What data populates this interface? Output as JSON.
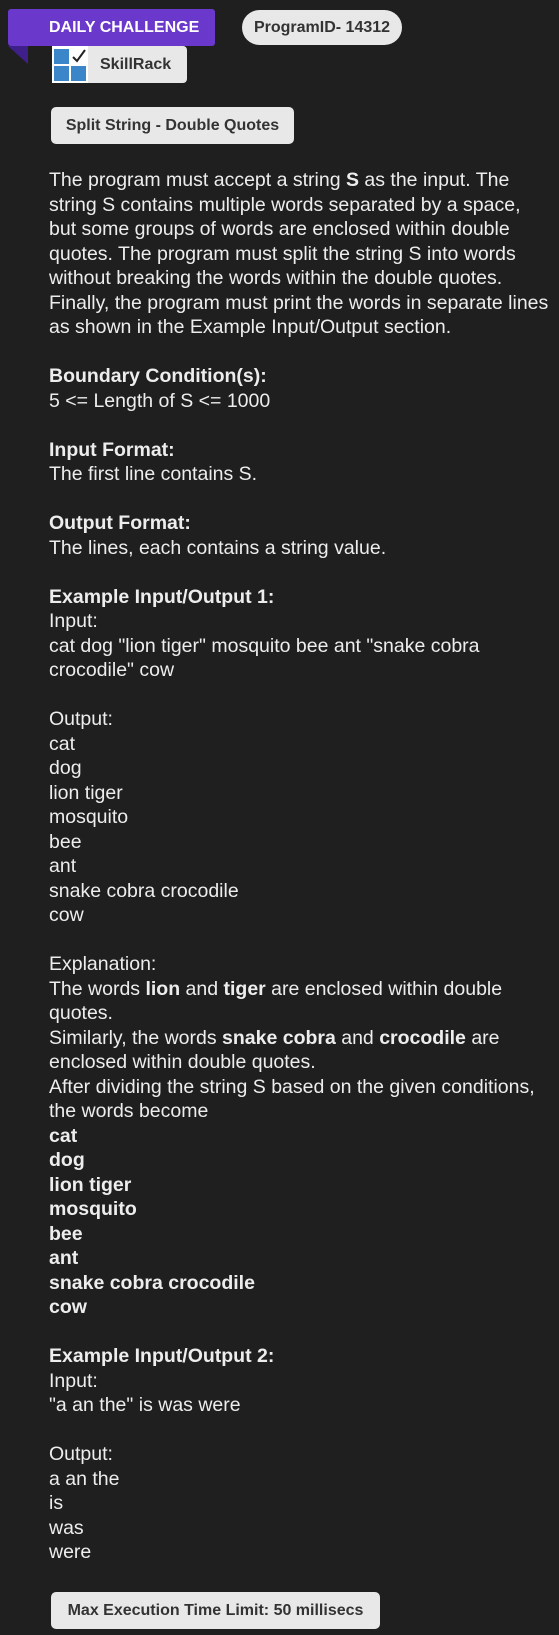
{
  "header": {
    "badge": "DAILY CHALLENGE",
    "program_id": "ProgramID- 14312",
    "brand": "SkillRack"
  },
  "problem": {
    "title": "Split String - Double Quotes",
    "desc_1": "The program must accept a string ",
    "desc_S": "S",
    "desc_2": " as the input. The string S contains multiple words separated by a space, but some groups of words are enclosed within double quotes. The program must split the string S into words without breaking the words within the double quotes. Finally, the program must print the words in separate lines as shown in the Example Input/Output section.",
    "boundary_heading": "Boundary Condition(s):",
    "boundary_text": "5 <= Length of S <= 1000",
    "input_heading": "Input Format:",
    "input_text": "The first line contains S.",
    "output_heading": "Output Format:",
    "output_text": "The lines, each contains a string value."
  },
  "example1": {
    "heading": "Example Input/Output 1:",
    "input_label": "Input:",
    "input_value": "cat dog \"lion tiger\" mosquito bee ant \"snake cobra crocodile\" cow",
    "output_label": "Output:",
    "output_lines": [
      "cat",
      "dog",
      "lion tiger",
      "mosquito",
      "bee",
      "ant",
      "snake cobra crocodile",
      "cow"
    ],
    "explanation_label": "Explanation:",
    "exp_a1": "The words ",
    "exp_a_b1": "lion",
    "exp_a2": " and ",
    "exp_a_b2": "tiger",
    "exp_a3": " are enclosed within double quotes.",
    "exp_b1": "Similarly, the words ",
    "exp_b_b1": "snake cobra",
    "exp_b2": " and ",
    "exp_b_b2": "crocodile",
    "exp_b3": " are enclosed within double quotes.",
    "exp_c": "After dividing the string S based on the given conditions, the words become",
    "bold_lines": [
      "cat",
      "dog",
      "lion tiger",
      "mosquito",
      "bee",
      "ant",
      "snake cobra crocodile",
      "cow"
    ]
  },
  "example2": {
    "heading": "Example Input/Output 2:",
    "input_label": "Input:",
    "input_value": "\"a an the\" is was were",
    "output_label": "Output:",
    "output_lines": [
      "a an the",
      "is",
      "was",
      "were"
    ]
  },
  "footer": {
    "time_limit": "Max Execution Time Limit: 50 millisecs"
  }
}
